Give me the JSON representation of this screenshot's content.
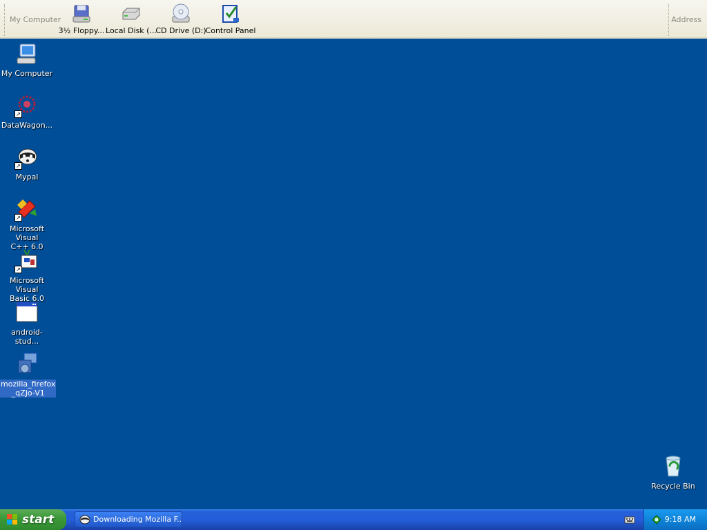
{
  "toolbar": {
    "title": "My Computer",
    "items": [
      {
        "label": "3½ Floppy...",
        "icon": "floppy-icon"
      },
      {
        "label": "Local Disk (...",
        "icon": "hard-disk-icon"
      },
      {
        "label": "CD Drive (D:)",
        "icon": "cd-drive-icon"
      },
      {
        "label": "Control Panel",
        "icon": "control-panel-icon"
      }
    ],
    "address_label": "Address"
  },
  "desktop": {
    "icons": [
      {
        "label": "My Computer",
        "icon": "my-computer-icon"
      },
      {
        "label": "DataWagon...",
        "icon": "datawagon-icon",
        "shortcut": true
      },
      {
        "label": "Mypal",
        "icon": "mypal-icon",
        "shortcut": true
      },
      {
        "label_line1": "Microsoft Visual",
        "label_line2": "C++ 6.0",
        "icon": "visual-cpp-icon",
        "shortcut": true
      },
      {
        "label_line1": "Microsoft Visual",
        "label_line2": "Basic 6.0",
        "icon": "visual-basic-icon",
        "shortcut": true
      },
      {
        "label": "android-stud...",
        "icon": "window-icon"
      },
      {
        "label_line1": "mozilla_firefox",
        "label_line2": "_qZJo-V1",
        "icon": "installer-icon",
        "selected": true
      },
      {
        "label": "Recycle Bin",
        "icon": "recycle-bin-icon"
      }
    ]
  },
  "taskbar": {
    "start_label": "start",
    "task_label": "Downloading Mozilla F...",
    "clock": "9:18 AM"
  },
  "colors": {
    "desktop_bg": "#004e98",
    "taskbar_blue": "#245edb",
    "start_green": "#3c9a3a",
    "tray_blue": "#0f84d9",
    "selection": "#316ac5"
  }
}
